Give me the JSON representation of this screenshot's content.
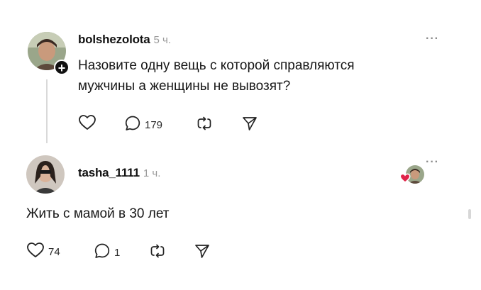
{
  "post": {
    "username": "bolshezolota",
    "time": "5 ч.",
    "text_line1": "Назовите одну вещь с которой справляются",
    "text_line2": "мужчины а женщины не вывозят?",
    "replies_count": "179",
    "menu_label": "···"
  },
  "reply": {
    "username": "tasha_1111",
    "time": "1 ч.",
    "text": "Жить с мамой в 30 лет",
    "likes_count": "74",
    "replies_count": "1",
    "menu_label": "···"
  },
  "icons": {
    "plus_badge": "+"
  },
  "colors": {
    "text": "#111111",
    "muted": "#9a9a9a",
    "heart_red": "#e0244a",
    "thread_line": "#d9d9d9"
  }
}
